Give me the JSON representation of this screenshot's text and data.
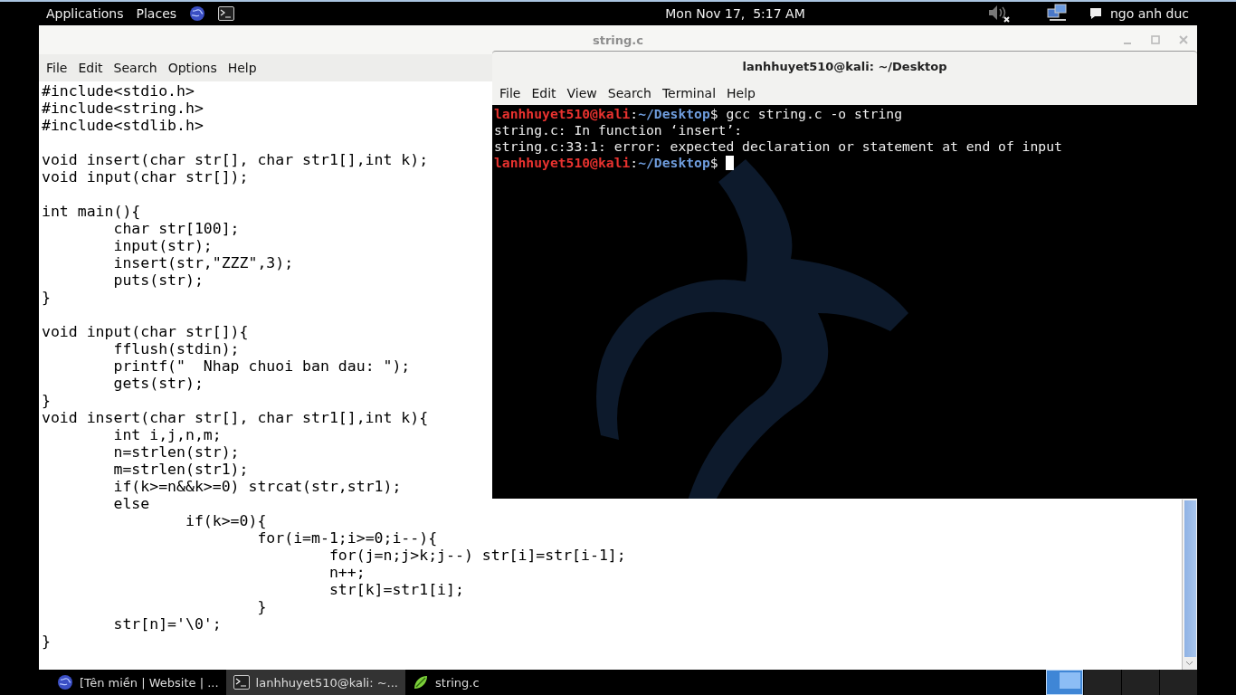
{
  "top_panel": {
    "menus": [
      "Applications",
      "Places"
    ],
    "launchers": [
      {
        "kind": "globe"
      },
      {
        "kind": "terminal"
      }
    ],
    "clock": "Mon Nov 17,  5:17 AM",
    "user": "ngo anh duc"
  },
  "editor": {
    "title": "string.c",
    "active": false,
    "menu": [
      "File",
      "Edit",
      "Search",
      "Options",
      "Help"
    ],
    "text": "#include<stdio.h>\n#include<string.h>\n#include<stdlib.h>\n\nvoid insert(char str[], char str1[],int k);\nvoid input(char str[]);\n\nint main(){\n\tchar str[100];\n\tinput(str);\n\tinsert(str,\"ZZZ\",3);\n\tputs(str);\n}\n\nvoid input(char str[]){\n\tfflush(stdin);\n\tprintf(\"  Nhap chuoi ban dau: \");\n\tgets(str);\n}\nvoid insert(char str[], char str1[],int k){\n\tint i,j,n,m;\n\tn=strlen(str);\n\tm=strlen(str1);\n\tif(k>=n&&k>=0) strcat(str,str1);\n\telse\n\t\tif(k>=0){\n\t\t\tfor(i=m-1;i>=0;i--){\n\t\t\t\tfor(j=n;j>k;j--) str[i]=str[i-1];\n\t\t\t\tn++;\n\t\t\t\tstr[k]=str1[i];\n\t\t\t}\n\tstr[n]='\\0';\n}"
  },
  "terminal": {
    "title": "lanhhuyet510@kali: ~/Desktop",
    "active": true,
    "menu": [
      "File",
      "Edit",
      "View",
      "Search",
      "Terminal",
      "Help"
    ],
    "lines": [
      {
        "kind": "prompt",
        "user": "lanhhuyet510@kali",
        "sep": ":",
        "path": "~/Desktop",
        "sign": "$",
        "command": "gcc string.c -o string",
        "cursor": false
      },
      {
        "kind": "output",
        "text": "string.c: In function ‘insert’:"
      },
      {
        "kind": "output",
        "text": "string.c:33:1: error: expected declaration or statement at end of input"
      },
      {
        "kind": "prompt",
        "user": "lanhhuyet510@kali",
        "sep": ":",
        "path": "~/Desktop",
        "sign": "$",
        "cursor": true
      }
    ]
  },
  "taskbar": {
    "items": [
      {
        "kind": "globe",
        "label": "[Tên miền | Website | ...",
        "selected": false
      },
      {
        "kind": "terminal",
        "label": "lanhhuyet510@kali: ~...",
        "selected": true
      },
      {
        "kind": "editor",
        "label": "string.c",
        "selected": false
      }
    ],
    "workspaces": [
      {
        "selected": true
      },
      {
        "selected": false
      },
      {
        "selected": false
      },
      {
        "selected": false
      }
    ]
  }
}
